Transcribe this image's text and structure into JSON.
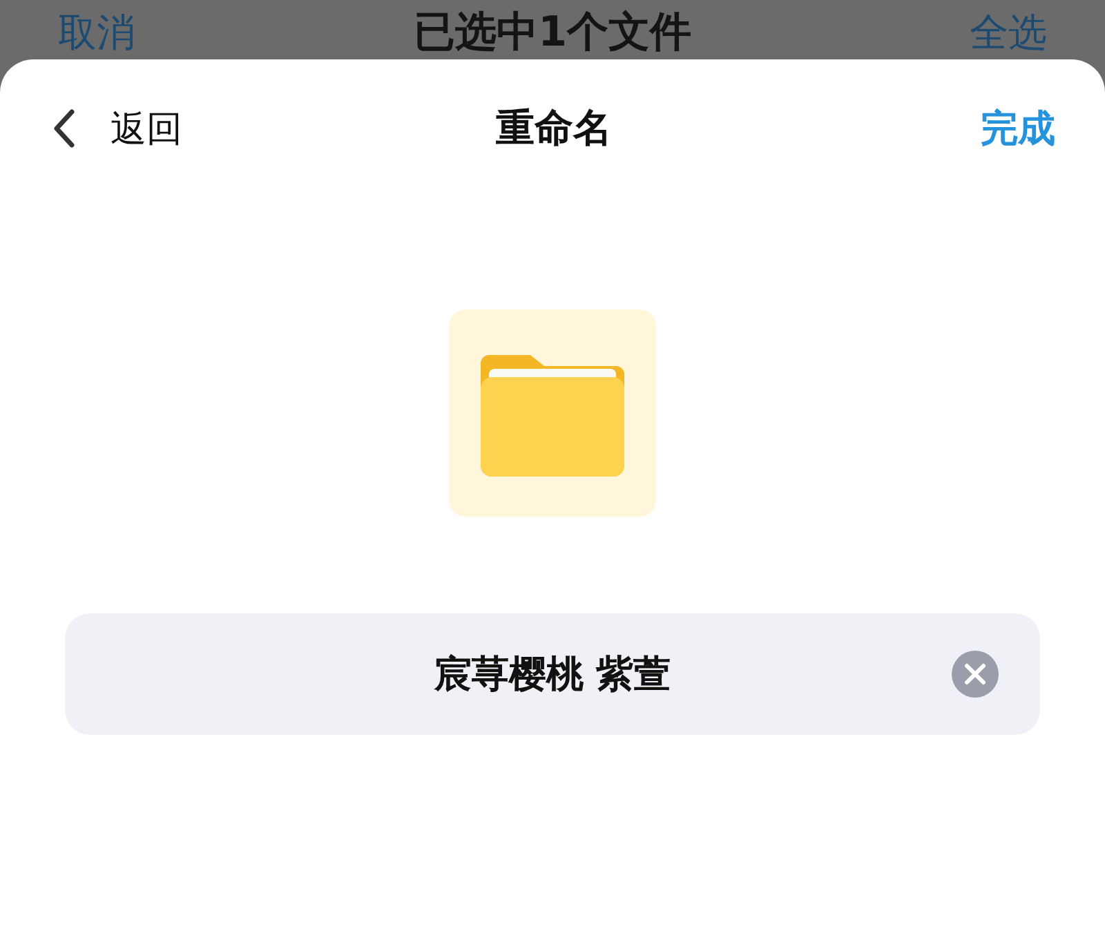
{
  "background_bar": {
    "cancel": "取消",
    "title": "已选中1个文件",
    "select_all": "全选"
  },
  "sheet": {
    "back": "返回",
    "title": "重命名",
    "done": "完成"
  },
  "file": {
    "kind": "folder"
  },
  "name_field": {
    "value": "宸荨樱桃 紫萱"
  }
}
